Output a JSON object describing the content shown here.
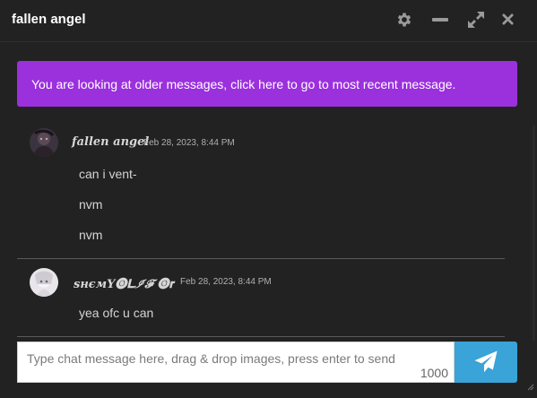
{
  "window": {
    "title": "fallen angel",
    "icons": [
      "gear-icon",
      "minimize-icon",
      "expand-icon",
      "close-icon"
    ]
  },
  "notice": {
    "text": "You are looking at older messages, click here to go to most recent message.",
    "color": "#9b30dd"
  },
  "messages": [
    {
      "username": "fallen angel",
      "timestamp": "Feb 28, 2023, 8:44 PM",
      "lines": [
        "can i vent-",
        "nvm",
        "nvm"
      ]
    },
    {
      "username": "ѕнємY🅞𝐋ℐ𝓕 🅞𝐫",
      "timestamp": "Feb 28, 2023, 8:44 PM",
      "lines": [
        "yea ofc u can"
      ]
    }
  ],
  "composer": {
    "placeholder": "Type chat message here, drag & drop images, press enter to send",
    "char_count": "1000",
    "send_color": "#3aa3d8"
  }
}
